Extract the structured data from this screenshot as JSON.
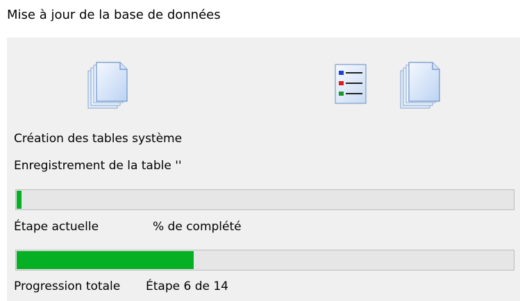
{
  "window": {
    "title": "Mise à jour de la base de données"
  },
  "status": {
    "main": "Création des tables système",
    "detail": "Enregistrement de la table ''"
  },
  "current_step": {
    "label": "Étape actuelle",
    "percent_text": "% de complété",
    "progress_fraction": 0.01
  },
  "total": {
    "label": "Progression totale",
    "step_text": "Étape 6 de 14",
    "progress_fraction": 0.357
  },
  "colors": {
    "progress_fill": "#06b025",
    "panel_bg": "#f0f0f0"
  },
  "icons": [
    "documents-stack-icon",
    "list-icon",
    "documents-stack-icon"
  ]
}
